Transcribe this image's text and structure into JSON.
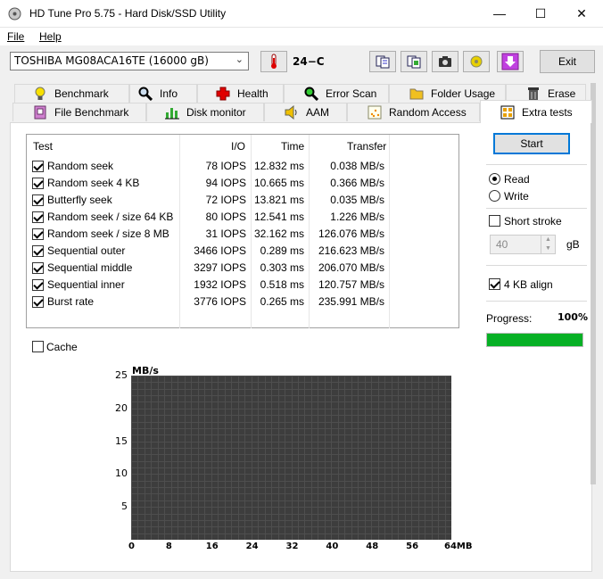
{
  "window": {
    "title": "HD Tune Pro 5.75 - Hard Disk/SSD Utility",
    "minimize": "—",
    "maximize": "☐",
    "close": "✕"
  },
  "menu": {
    "file": "File",
    "help": "Help"
  },
  "toolbar": {
    "drive": "TOSHIBA MG08ACA16TE (16000 gB)",
    "temperature": "24−C",
    "exit_label": "Exit"
  },
  "tabs_row1": [
    {
      "label": "Benchmark",
      "icon": "lightbulb-icon"
    },
    {
      "label": "Info",
      "icon": "magnifier-icon"
    },
    {
      "label": "Health",
      "icon": "red-cross-icon"
    },
    {
      "label": "Error Scan",
      "icon": "magnifier-icon"
    },
    {
      "label": "Folder Usage",
      "icon": "folder-icon"
    },
    {
      "label": "Erase",
      "icon": "trash-icon"
    }
  ],
  "tabs_row2": [
    {
      "label": "File Benchmark",
      "icon": "file-icon"
    },
    {
      "label": "Disk monitor",
      "icon": "bar-chart-icon"
    },
    {
      "label": "AAM",
      "icon": "speaker-icon"
    },
    {
      "label": "Random Access",
      "icon": "scatter-icon"
    },
    {
      "label": "Extra tests",
      "icon": "grid-icon"
    }
  ],
  "table": {
    "headers": {
      "test": "Test",
      "io": "I/O",
      "time": "Time",
      "transfer": "Transfer"
    },
    "rows": [
      {
        "name": "Random seek",
        "io": "78 IOPS",
        "time": "12.832 ms",
        "transfer": "0.038 MB/s"
      },
      {
        "name": "Random seek 4 KB",
        "io": "94 IOPS",
        "time": "10.665 ms",
        "transfer": "0.366 MB/s"
      },
      {
        "name": "Butterfly seek",
        "io": "72 IOPS",
        "time": "13.821 ms",
        "transfer": "0.035 MB/s"
      },
      {
        "name": "Random seek / size 64 KB",
        "io": "80 IOPS",
        "time": "12.541 ms",
        "transfer": "1.226 MB/s"
      },
      {
        "name": "Random seek / size 8 MB",
        "io": "31 IOPS",
        "time": "32.162 ms",
        "transfer": "126.076 MB/s"
      },
      {
        "name": "Sequential outer",
        "io": "3466 IOPS",
        "time": "0.289 ms",
        "transfer": "216.623 MB/s"
      },
      {
        "name": "Sequential middle",
        "io": "3297 IOPS",
        "time": "0.303 ms",
        "transfer": "206.070 MB/s"
      },
      {
        "name": "Sequential inner",
        "io": "1932 IOPS",
        "time": "0.518 ms",
        "transfer": "120.757 MB/s"
      },
      {
        "name": "Burst rate",
        "io": "3776 IOPS",
        "time": "0.265 ms",
        "transfer": "235.991 MB/s"
      }
    ]
  },
  "controls": {
    "start": "Start",
    "read": "Read",
    "write": "Write",
    "short_stroke": "Short stroke",
    "stroke_value": "40",
    "stroke_unit": "gB",
    "align": "4 KB align",
    "progress_label": "Progress:",
    "progress_text": "100%",
    "progress_fraction": 1.0,
    "cache": "Cache"
  },
  "chart_data": {
    "type": "line",
    "ylabel": "MB/s",
    "yticks": [
      "25",
      "20",
      "15",
      "10",
      "5"
    ],
    "xticks": [
      "0",
      "8",
      "16",
      "24",
      "32",
      "40",
      "48",
      "56",
      "64MB"
    ],
    "ylim": [
      0,
      25
    ],
    "xlim": [
      0,
      64
    ],
    "series": []
  },
  "colors": {
    "progress": "#06b025",
    "accent": "#0078d7",
    "chart_bg": "#3d3d3d"
  }
}
